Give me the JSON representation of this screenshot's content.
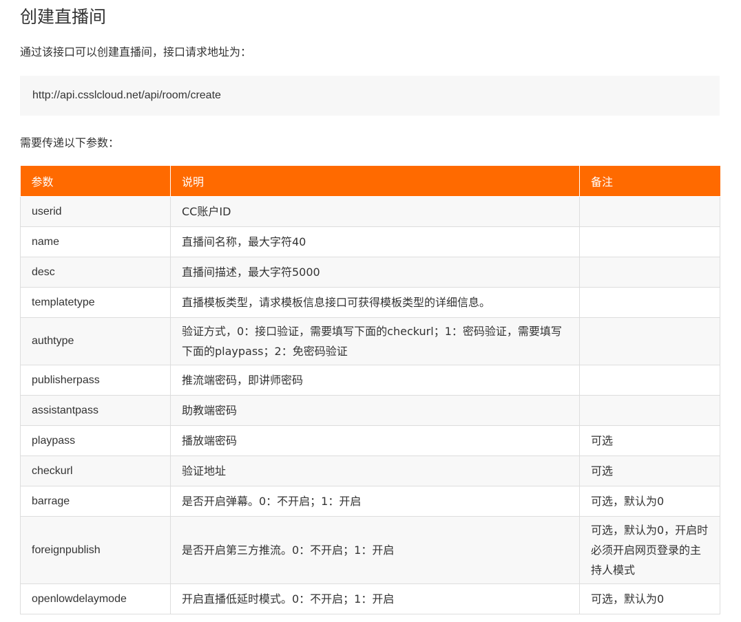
{
  "title": "创建直播间",
  "intro": "通过该接口可以创建直播间，接口请求地址为：",
  "api_url": "http://api.csslcloud.net/api/room/create",
  "params_label": "需要传递以下参数：",
  "colors": {
    "header_bg": "#ff6a00",
    "header_text": "#ffffff",
    "stripe": "#f8f8f8",
    "code_bg": "#f7f7f7",
    "border": "#dddddd"
  },
  "table": {
    "headers": [
      "参数",
      "说明",
      "备注"
    ],
    "rows": [
      {
        "name": "userid",
        "desc": "CC账户ID",
        "note": ""
      },
      {
        "name": "name",
        "desc": "直播间名称，最大字符40",
        "note": ""
      },
      {
        "name": "desc",
        "desc": "直播间描述，最大字符5000",
        "note": ""
      },
      {
        "name": "templatetype",
        "desc": "直播模板类型，请求模板信息接口可获得模板类型的详细信息。",
        "note": ""
      },
      {
        "name": "authtype",
        "desc": "验证方式，0：接口验证，需要填写下面的checkurl；1：密码验证，需要填写下面的playpass；2：免密码验证",
        "note": ""
      },
      {
        "name": "publisherpass",
        "desc": "推流端密码，即讲师密码",
        "note": ""
      },
      {
        "name": "assistantpass",
        "desc": "助教端密码",
        "note": ""
      },
      {
        "name": "playpass",
        "desc": "播放端密码",
        "note": "可选"
      },
      {
        "name": "checkurl",
        "desc": "验证地址",
        "note": "可选"
      },
      {
        "name": "barrage",
        "desc": "是否开启弹幕。0：不开启；1：开启",
        "note": "可选，默认为0"
      },
      {
        "name": "foreignpublish",
        "desc": "是否开启第三方推流。0：不开启；1：开启",
        "note": "可选，默认为0，开启时必须开启网页登录的主持人模式"
      },
      {
        "name": "openlowdelaymode",
        "desc": "开启直播低延时模式。0：不开启；1：开启",
        "note": "可选，默认为0"
      }
    ]
  }
}
